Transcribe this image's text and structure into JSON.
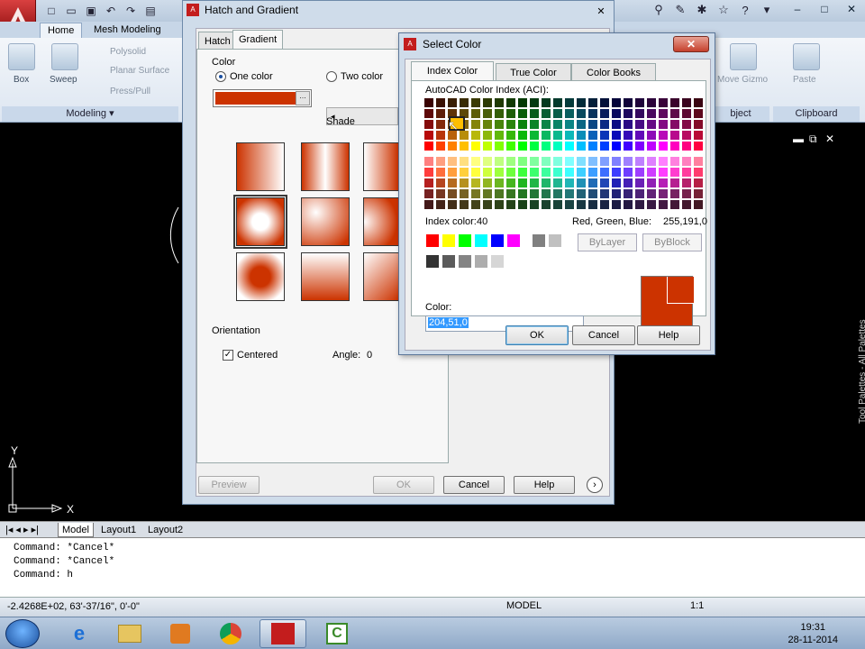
{
  "ribbon": {
    "tabs": [
      "Home",
      "Mesh Modeling"
    ],
    "modeling": {
      "box": "Box",
      "sweep": "Sweep",
      "polysolid": "Polysolid",
      "planar_surface": "Planar Surface",
      "press_pull": "Press/Pull",
      "panel_title": "Modeling"
    },
    "move_gizmo": "Move Gizmo",
    "paste": "Paste",
    "object_panel": "bject",
    "clipboard_panel": "Clipboard"
  },
  "hatch_dialog": {
    "title": "Hatch and Gradient",
    "tabs": [
      "Hatch",
      "Gradient"
    ],
    "color_group": "Color",
    "one_color": "One color",
    "two_color": "Two color",
    "shade": "Shade",
    "orientation_group": "Orientation",
    "centered": "Centered",
    "angle_label": "Angle:",
    "angle_value": "0",
    "buttons": {
      "preview": "Preview",
      "ok": "OK",
      "cancel": "Cancel",
      "help": "Help"
    },
    "gradient_color": "#cc3300"
  },
  "select_color": {
    "title": "Select Color",
    "tabs": [
      "Index Color",
      "True Color",
      "Color Books"
    ],
    "aci_label": "AutoCAD Color Index (ACI):",
    "index_label": "Index color:",
    "index_value": "40",
    "rgb_label": "Red, Green, Blue:",
    "rgb_value": "255,191,0",
    "bylayer": "ByLayer",
    "byblock": "ByBlock",
    "color_label": "Color:",
    "color_value": "204,51,0",
    "buttons": {
      "ok": "OK",
      "cancel": "Cancel",
      "help": "Help"
    },
    "selected_color": "#cc3300",
    "highlight_color": "#ffbf00"
  },
  "layout_tabs": [
    "Model",
    "Layout1",
    "Layout2"
  ],
  "command_history": [
    "Command: *Cancel*",
    "Command: *Cancel*",
    "Command: h"
  ],
  "status": {
    "coords": "-2.4268E+02, 63'-37/16\", 0'-0\"",
    "model": "MODEL",
    "scale": "1:1"
  },
  "ucs": {
    "x": "X",
    "y": "Y"
  },
  "tool_palettes": "Tool Palettes - All Palettes",
  "taskbar": {
    "time": "19:31",
    "date": "28-11-2014"
  }
}
